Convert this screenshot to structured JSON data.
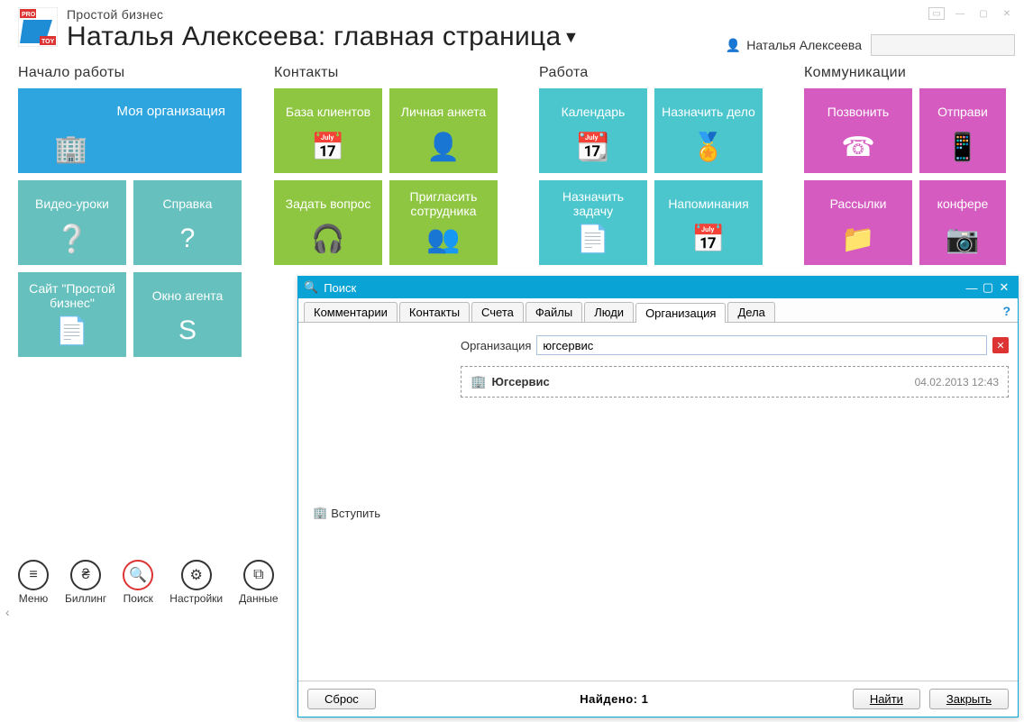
{
  "header": {
    "app_name": "Простой бизнес",
    "page_title": "Наталья Алексеева: главная страница",
    "user_name": "Наталья Алексеева",
    "search_placeholder": ""
  },
  "columns": [
    {
      "title": "Начало работы",
      "tiles": [
        {
          "label": "Моя организация",
          "wide": true,
          "color": "c-blue",
          "icon": "🏢",
          "name": "tile-my-org"
        },
        {
          "label": "Видео-уроки",
          "color": "c-teal2",
          "icon": "❔",
          "name": "tile-video-lessons",
          "iconbox": true,
          "iconchar": "?"
        },
        {
          "label": "Справка",
          "color": "c-teal2",
          "icon": "?",
          "name": "tile-help"
        },
        {
          "label": "Сайт \"Простой бизнес\"",
          "color": "c-teal2",
          "icon": "📄",
          "name": "tile-site"
        },
        {
          "label": "Окно агента",
          "color": "c-teal2",
          "icon": "S",
          "name": "tile-agent-window"
        }
      ]
    },
    {
      "title": "Контакты",
      "tiles": [
        {
          "label": "База клиентов",
          "color": "c-green",
          "icon": "📅",
          "name": "tile-client-db"
        },
        {
          "label": "Личная анкета",
          "color": "c-green",
          "icon": "👤",
          "name": "tile-personal-form"
        },
        {
          "label": "Задать вопрос",
          "color": "c-green",
          "icon": "🎧",
          "name": "tile-ask-question"
        },
        {
          "label": "Пригласить сотрудника",
          "color": "c-green",
          "icon": "👥",
          "name": "tile-invite-employee"
        }
      ]
    },
    {
      "title": "Работа",
      "tiles": [
        {
          "label": "Календарь",
          "color": "c-teal",
          "icon": "📆",
          "name": "tile-calendar"
        },
        {
          "label": "Назначить дело",
          "color": "c-teal",
          "icon": "🏅",
          "name": "tile-assign-case"
        },
        {
          "label": "Назначить задачу",
          "color": "c-teal",
          "icon": "📄",
          "name": "tile-assign-task"
        },
        {
          "label": "Напоминания",
          "color": "c-teal",
          "icon": "📅",
          "name": "tile-reminders"
        }
      ]
    },
    {
      "title": "Коммуникации",
      "tiles": [
        {
          "label": "Позвонить",
          "color": "c-magenta",
          "icon": "☎",
          "name": "tile-call"
        },
        {
          "label": "Отправи",
          "color": "c-magenta",
          "icon": "📱",
          "name": "tile-send",
          "cut": true
        },
        {
          "label": "Рассылки",
          "color": "c-magenta",
          "icon": "📁",
          "name": "tile-mailings"
        },
        {
          "label": "конфере",
          "color": "c-magenta",
          "icon": "📷",
          "name": "tile-conference",
          "cut": true
        }
      ]
    }
  ],
  "bottom_bar": [
    {
      "label": "Меню",
      "icon": "≡",
      "name": "menu-button"
    },
    {
      "label": "Биллинг",
      "icon": "₴",
      "name": "billing-button"
    },
    {
      "label": "Поиск",
      "icon": "🔍",
      "name": "search-button",
      "active": true
    },
    {
      "label": "Настройки",
      "icon": "⚙",
      "name": "settings-button"
    },
    {
      "label": "Данные",
      "icon": "⧉",
      "name": "data-button"
    }
  ],
  "search_dialog": {
    "title": "Поиск",
    "tabs": [
      "Комментарии",
      "Контакты",
      "Счета",
      "Файлы",
      "Люди",
      "Организация",
      "Дела"
    ],
    "active_tab": "Организация",
    "org_label": "Организация",
    "org_value": "югсервис",
    "result_name": "Югсервис",
    "result_date": "04.02.2013 12:43",
    "join_label": "Вступить",
    "found_label": "Найдено: 1",
    "reset_btn": "Сброс",
    "find_btn": "Найти",
    "close_btn": "Закрыть"
  }
}
